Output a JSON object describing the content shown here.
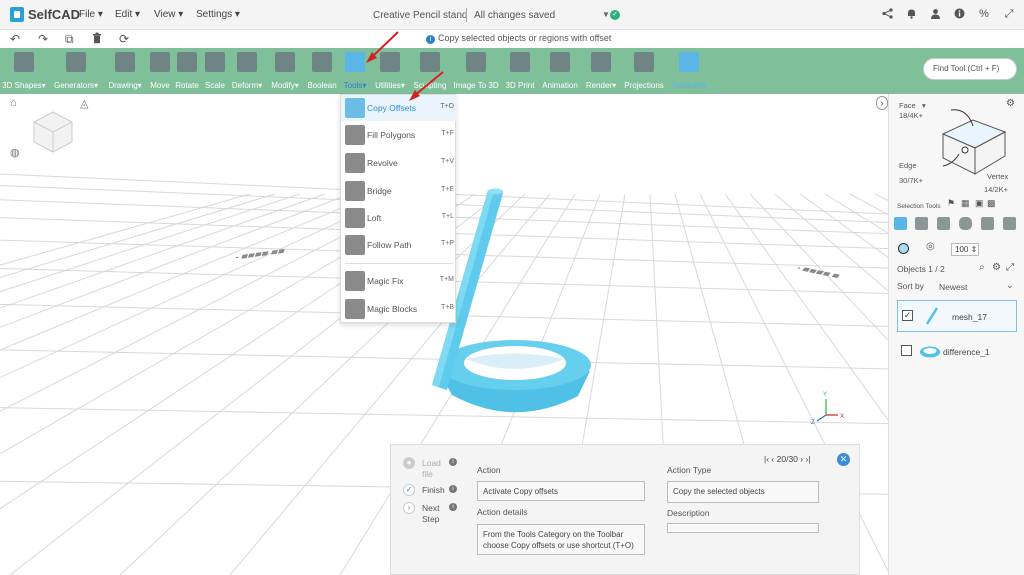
{
  "app": {
    "name": "SelfCAD"
  },
  "menus": [
    "File",
    "Edit",
    "View",
    "Settings"
  ],
  "project": {
    "title": "Creative Pencil stand",
    "save_status": "All changes saved"
  },
  "hint": "Copy selected objects or regions with offset",
  "toolbar": {
    "items": [
      {
        "label": "3D Shapes"
      },
      {
        "label": "Generators"
      },
      {
        "label": "Drawing"
      },
      {
        "label": "Move"
      },
      {
        "label": "Rotate"
      },
      {
        "label": "Scale"
      },
      {
        "label": "Deform"
      },
      {
        "label": "Modify"
      },
      {
        "label": "Boolean"
      },
      {
        "label": "Tools"
      },
      {
        "label": "Utilities"
      },
      {
        "label": "Sculpting"
      },
      {
        "label": "Image To 3D"
      },
      {
        "label": "3D Print"
      },
      {
        "label": "Animation"
      },
      {
        "label": "Render"
      },
      {
        "label": "Projections"
      },
      {
        "label": "Tutorials"
      }
    ],
    "find_tool_placeholder": "Find Tool (Ctrl + F)"
  },
  "tools_menu": {
    "items": [
      {
        "label": "Copy Offsets",
        "shortcut": "T+O"
      },
      {
        "label": "Fill Polygons",
        "shortcut": "T+F"
      },
      {
        "label": "Revolve",
        "shortcut": "T+V"
      },
      {
        "label": "Bridge",
        "shortcut": "T+E"
      },
      {
        "label": "Loft",
        "shortcut": "T+L"
      },
      {
        "label": "Follow Path",
        "shortcut": "T+P"
      },
      {
        "label": "Magic Fix",
        "shortcut": "T+M"
      },
      {
        "label": "Magic Blocks",
        "shortcut": "T+B"
      }
    ]
  },
  "right_panel": {
    "face_label": "Face",
    "face_count": "18/4K+",
    "edge_label": "Edge",
    "edge_count": "30/7K+",
    "vertex_label": "Vertex",
    "vertex_count": "14/2K+",
    "selection_tools_label": "Selection Tools",
    "opacity_value": "100",
    "objects_label": "Objects 1 / 2",
    "sort_by_label": "Sort by",
    "sort_value": "Newest",
    "objects": [
      {
        "name": "mesh_17",
        "checked": true
      },
      {
        "name": "difference_1",
        "checked": false
      }
    ]
  },
  "tutorial": {
    "steps": [
      {
        "label": "Load file"
      },
      {
        "label": "Finish"
      },
      {
        "label": "Next Step"
      }
    ],
    "nav": "20/30",
    "action_label": "Action",
    "action_value": "Activate Copy offsets",
    "action_details_label": "Action details",
    "action_details_value": "From the Tools Category on the Toolbar choose Copy offsets or use shortcut  (T+O)",
    "action_type_label": "Action Type",
    "action_type_value": "Copy the selected objects",
    "description_label": "Description",
    "description_value": ""
  },
  "colors": {
    "toolbar_bg": "#7fbf9a",
    "accent": "#2a8fd8",
    "object": "#5ec8ea",
    "arrow": "#d81f1f"
  }
}
